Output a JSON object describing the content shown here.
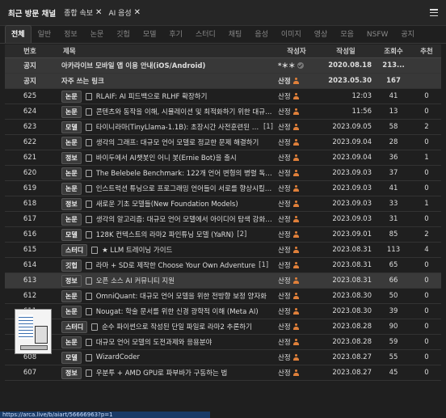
{
  "header": {
    "title": "최근 방문 채널",
    "chips": [
      "종합 속보",
      "AI 음성"
    ]
  },
  "tabs": [
    "전체",
    "일반",
    "정보",
    "논문",
    "깃헙",
    "모델",
    "후기",
    "스터디",
    "채팅",
    "음성",
    "이미지",
    "영상",
    "모음",
    "NSFW",
    "공지"
  ],
  "columns": {
    "num": "번호",
    "title": "제목",
    "author": "작성자",
    "date": "작성일",
    "views": "조회수",
    "rec": "추천"
  },
  "rows": [
    {
      "num": "공지",
      "badge": "",
      "title": "아카라이브 모바일 앱 이용 안내(iOS/Android)",
      "comments": "",
      "author": "*＊＊",
      "date": "2020.08.18",
      "views": "213...",
      "rec": ""
    },
    {
      "num": "공지",
      "badge": "",
      "title": "자주 쓰는 링크",
      "comments": "",
      "author": "산정",
      "date": "2023.05.30",
      "views": "167",
      "rec": ""
    },
    {
      "num": "625",
      "badge": "논문",
      "title": "RLAIF: AI 피드백으로 RLHF 확장하기",
      "comments": "",
      "author": "산정",
      "date": "12:03",
      "views": "41",
      "rec": "0"
    },
    {
      "num": "624",
      "badge": "논문",
      "title": "콘텐츠와 동작을 이해, 시뮬레이션 및 최적화하기 위한 대규모 ...",
      "comments": "",
      "author": "산정",
      "date": "11:56",
      "views": "13",
      "rec": "0"
    },
    {
      "num": "623",
      "badge": "모델",
      "title": "타이니라마(TinyLlama-1.1B): 초장시간 사전훈련된 컴팩트...",
      "comments": "[1]",
      "author": "산정",
      "date": "2023.09.05",
      "views": "58",
      "rec": "2"
    },
    {
      "num": "622",
      "badge": "논문",
      "title": "생각의 그래프: 대규모 언어 모델로 정교한 문제 해결하기",
      "comments": "",
      "author": "산정",
      "date": "2023.09.04",
      "views": "28",
      "rec": "0"
    },
    {
      "num": "621",
      "badge": "정보",
      "title": "바이두에서 AI챗봇인 어니 봇(Ernie Bot)을 출시",
      "comments": "",
      "author": "산정",
      "date": "2023.09.04",
      "views": "36",
      "rec": "1"
    },
    {
      "num": "620",
      "badge": "논문",
      "title": "The Belebele Benchmark: 122개 언어 변형의 병렬 독해력 ...",
      "comments": "",
      "author": "산정",
      "date": "2023.09.03",
      "views": "37",
      "rec": "0"
    },
    {
      "num": "619",
      "badge": "논문",
      "title": "인스트럭션 튜닝으로 프로그래밍 언어들이 서로를 향상시킬 수 ...",
      "comments": "",
      "author": "산정",
      "date": "2023.09.03",
      "views": "41",
      "rec": "0"
    },
    {
      "num": "618",
      "badge": "정보",
      "title": "새로운 기초 모델들(New Foundation Models)",
      "comments": "",
      "author": "산정",
      "date": "2023.09.03",
      "views": "33",
      "rec": "1"
    },
    {
      "num": "617",
      "badge": "논문",
      "title": "생각의 알고리즘: 대규모 언어 모델에서 아이디어 탐색 강화하기...",
      "comments": "",
      "author": "산정",
      "date": "2023.09.03",
      "views": "31",
      "rec": "0"
    },
    {
      "num": "616",
      "badge": "모델",
      "title": "128K 컨텍스트의 라마2 파인튜닝 모델 (YaRN)",
      "comments": "[2]",
      "author": "산정",
      "date": "2023.09.01",
      "views": "85",
      "rec": "2"
    },
    {
      "num": "615",
      "badge": "스터디",
      "title": "★ LLM 트레이닝 가이드",
      "comments": "",
      "author": "산정",
      "date": "2023.08.31",
      "views": "113",
      "rec": "4"
    },
    {
      "num": "614",
      "badge": "깃헙",
      "title": "라마 + SD로 제작한 Choose Your Own Adventure",
      "comments": "[1]",
      "author": "산정",
      "date": "2023.08.31",
      "views": "65",
      "rec": "0"
    },
    {
      "num": "613",
      "badge": "정보",
      "title": "오픈 소스 AI 커뮤니티 지원",
      "comments": "",
      "author": "산정",
      "date": "2023.08.31",
      "views": "66",
      "rec": "0"
    },
    {
      "num": "612",
      "badge": "논문",
      "title": "OmniQuant: 대규모 언어 모델을 위한 전방향 보정 양자화",
      "comments": "",
      "author": "산정",
      "date": "2023.08.30",
      "views": "50",
      "rec": "0"
    },
    {
      "num": "611",
      "badge": "논문",
      "title": "Nougat: 학술 문서를 위한 신경 광학적 이해 (Meta AI)",
      "comments": "",
      "author": "산정",
      "date": "2023.08.30",
      "views": "39",
      "rec": "0"
    },
    {
      "num": "610",
      "badge": "스터디",
      "title": "순수 파이썬으로 작성된 단일 파일로 라마2 추론하기",
      "comments": "",
      "author": "산정",
      "date": "2023.08.28",
      "views": "90",
      "rec": "0"
    },
    {
      "num": "609",
      "badge": "논문",
      "title": "대규모 언어 모델의 도전과제와 응용분야",
      "comments": "",
      "author": "산정",
      "date": "2023.08.28",
      "views": "59",
      "rec": "0"
    },
    {
      "num": "608",
      "badge": "모델",
      "title": "WizardCoder",
      "comments": "",
      "author": "산정",
      "date": "2023.08.27",
      "views": "55",
      "rec": "0"
    },
    {
      "num": "607",
      "badge": "정보",
      "title": "우분투 + AMD GPU로 파부바가 구동하는 법",
      "comments": "",
      "author": "산정",
      "date": "2023.08.27",
      "views": "45",
      "rec": "0"
    }
  ],
  "status_url": "https://arca.live/b/aiart/56666963?p=1"
}
